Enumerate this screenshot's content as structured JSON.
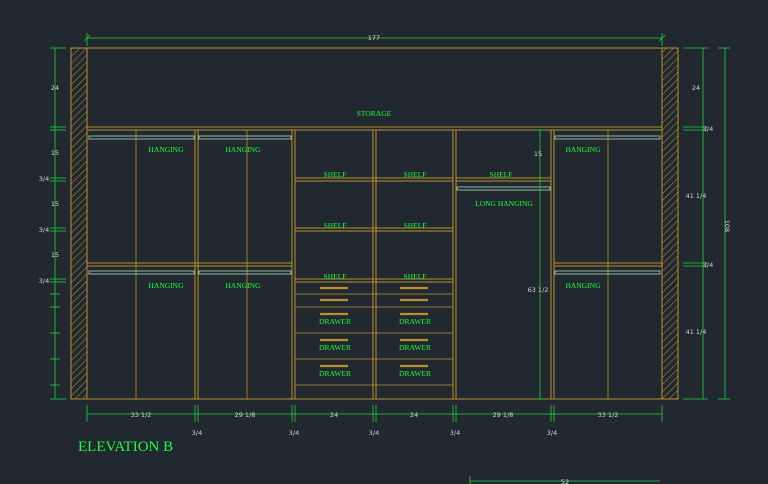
{
  "title": "ELEVATION B",
  "labels": {
    "storage": "STORAGE",
    "hanging": "HANGING",
    "shelf": "SHELF",
    "drawer": "DRAWER",
    "long_hanging": "LONG HANGING"
  },
  "dimensions": {
    "overall_width": "177",
    "overall_height": "108",
    "top_storage_height": "24",
    "hanging_height": "15",
    "gap": "3/4",
    "right_upper": "41 1/4",
    "right_lower": "41 1/4",
    "long_hanging_height": "63 1/2",
    "bottom_widths": [
      "33 1/2",
      "29 1/8",
      "24",
      "24",
      "29 1/8",
      "33 1/2"
    ],
    "bottom_gaps": [
      "3/4",
      "3/4",
      "3/4",
      "3/4",
      "3/4"
    ],
    "bottom_right_partial": "52"
  },
  "colors": {
    "background": "#212830",
    "casework": "#b8912c",
    "text": "#1fff3a",
    "dimension": "#1fd13a"
  }
}
